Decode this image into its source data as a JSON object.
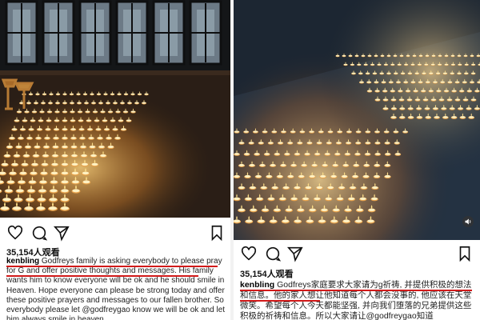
{
  "left_post": {
    "views": "35,154人观看",
    "username": "kenbling",
    "caption": "Godfreys family is asking everybody to please pray for G and offer positive thoughts and messages. His family wants him to know everyone will be ok and he should smile in Heaven.  Hope everyone can please be strong today and offer these positive prayers and messages to our fallen brother.  So everybody please let @godfreygao know we will be ok and let him always smile in heaven."
  },
  "right_post": {
    "views": "35,154人观看",
    "username": "kenbling",
    "caption": "Godfreys家庭要求大家请为g祈祷, 并提供积极的想法和信息。他的家人想让他知道每个人都会没事的, 他应该在天堂微笑。希望每个人今天都能坚强, 并向我们堕落的兄弟提供这些积极的祈祷和信息。所以大家请让@godfreygao知道"
  },
  "icons": [
    "heart-icon",
    "comment-icon",
    "share-icon",
    "bookmark-icon",
    "mute-icon"
  ],
  "colors": {
    "underline": "#d11a1a",
    "flame": "#ffb347",
    "background_dark": "#1b1410"
  }
}
